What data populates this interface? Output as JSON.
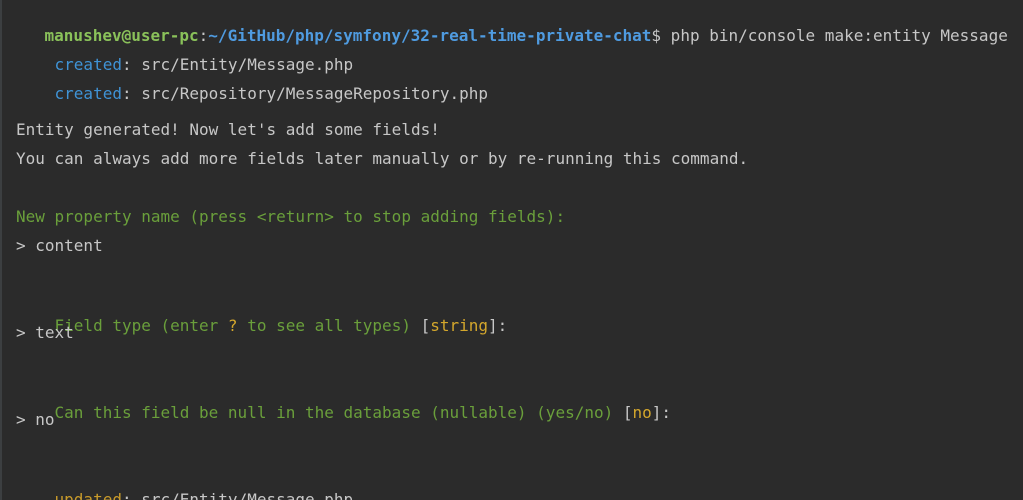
{
  "prompt": {
    "user_host": "manushev@user-pc",
    "colon": ":",
    "path": "~/GitHub/php/symfony/32-real-time-private-chat",
    "dollar": "$",
    "command": " php bin/console make:entity Message"
  },
  "created": [
    {
      "label": "created",
      "rest": ": src/Entity/Message.php"
    },
    {
      "label": "created",
      "rest": ": src/Repository/MessageRepository.php"
    }
  ],
  "info": {
    "line1": "Entity generated! Now let's add some fields!",
    "line2": "You can always add more fields later manually or by re-running this command."
  },
  "q1": {
    "question": "New property name (press <return> to stop adding fields):",
    "answer": "> content"
  },
  "q2": {
    "question_a": "Field type (enter ",
    "question_q": "?",
    "question_b": " to see all types) ",
    "bracket_open": "[",
    "default": "string",
    "bracket_close": "]:",
    "answer": "> text"
  },
  "q3": {
    "question": "Can this field be null in the database (nullable) (yes/no) ",
    "bracket_open": "[",
    "default": "no",
    "bracket_close": "]:",
    "answer": "> no"
  },
  "updated": {
    "label": "updated",
    "rest": ": src/Entity/Message.php"
  },
  "colors": {
    "background": "#2b2b2b",
    "default_text": "#c7c7c7",
    "prompt_user": "#8ac15a",
    "prompt_path": "#4f9be0",
    "created_label": "#3f93d6",
    "question_green": "#6a9f3b",
    "default_value_orange": "#d4a72c",
    "updated_label": "#c99b2a"
  }
}
